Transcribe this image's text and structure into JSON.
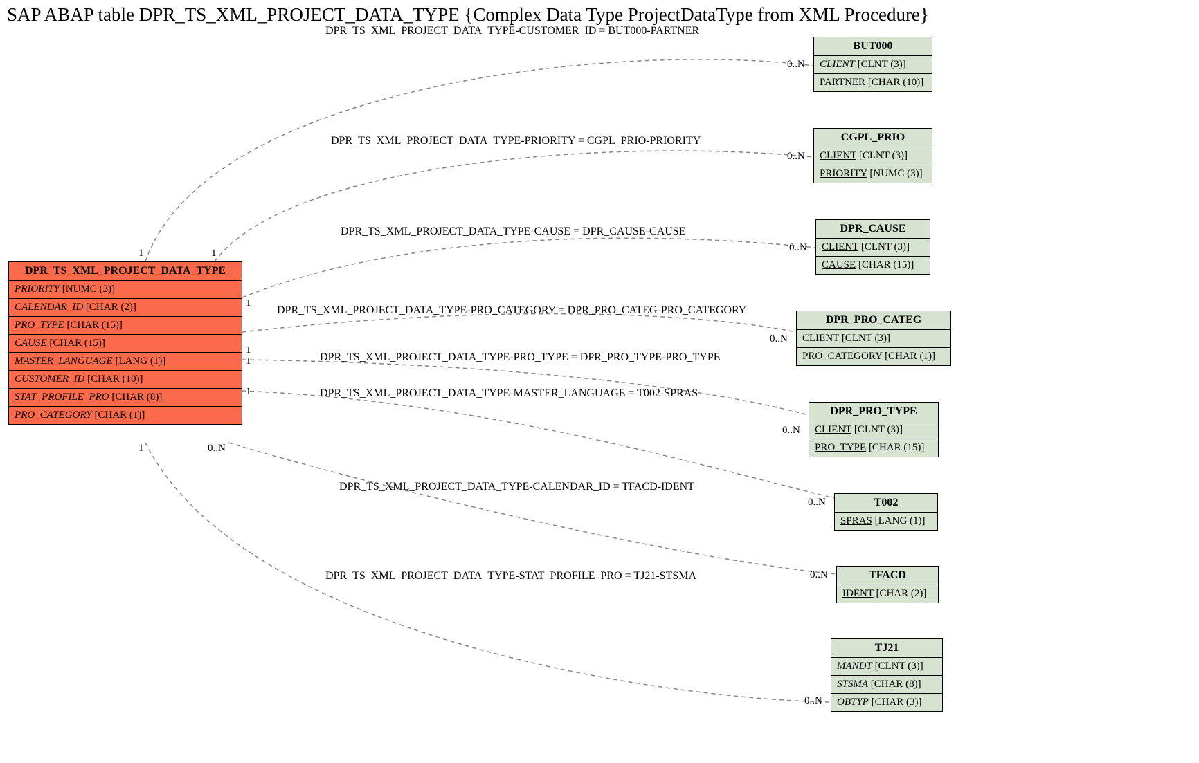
{
  "title": "SAP ABAP table DPR_TS_XML_PROJECT_DATA_TYPE {Complex Data Type ProjectDataType from XML Procedure}",
  "main_entity": {
    "name": "DPR_TS_XML_PROJECT_DATA_TYPE",
    "fields": [
      {
        "name": "PRIORITY",
        "type": "[NUMC (3)]"
      },
      {
        "name": "CALENDAR_ID",
        "type": "[CHAR (2)]"
      },
      {
        "name": "PRO_TYPE",
        "type": "[CHAR (15)]"
      },
      {
        "name": "CAUSE",
        "type": "[CHAR (15)]"
      },
      {
        "name": "MASTER_LANGUAGE",
        "type": "[LANG (1)]"
      },
      {
        "name": "CUSTOMER_ID",
        "type": "[CHAR (10)]"
      },
      {
        "name": "STAT_PROFILE_PRO",
        "type": "[CHAR (8)]"
      },
      {
        "name": "PRO_CATEGORY",
        "type": "[CHAR (1)]"
      }
    ]
  },
  "targets": [
    {
      "name": "BUT000",
      "fields": [
        {
          "name": "CLIENT",
          "type": "[CLNT (3)]",
          "italic": true
        },
        {
          "name": "PARTNER",
          "type": "[CHAR (10)]",
          "italic": false
        }
      ]
    },
    {
      "name": "CGPL_PRIO",
      "fields": [
        {
          "name": "CLIENT",
          "type": "[CLNT (3)]",
          "italic": false
        },
        {
          "name": "PRIORITY",
          "type": "[NUMC (3)]",
          "italic": false
        }
      ]
    },
    {
      "name": "DPR_CAUSE",
      "fields": [
        {
          "name": "CLIENT",
          "type": "[CLNT (3)]",
          "italic": false
        },
        {
          "name": "CAUSE",
          "type": "[CHAR (15)]",
          "italic": false
        }
      ]
    },
    {
      "name": "DPR_PRO_CATEG",
      "fields": [
        {
          "name": "CLIENT",
          "type": "[CLNT (3)]",
          "italic": false
        },
        {
          "name": "PRO_CATEGORY",
          "type": "[CHAR (1)]",
          "italic": false
        }
      ]
    },
    {
      "name": "DPR_PRO_TYPE",
      "fields": [
        {
          "name": "CLIENT",
          "type": "[CLNT (3)]",
          "italic": false
        },
        {
          "name": "PRO_TYPE",
          "type": "[CHAR (15)]",
          "italic": false
        }
      ]
    },
    {
      "name": "T002",
      "fields": [
        {
          "name": "SPRAS",
          "type": "[LANG (1)]",
          "italic": false
        }
      ]
    },
    {
      "name": "TFACD",
      "fields": [
        {
          "name": "IDENT",
          "type": "[CHAR (2)]",
          "italic": false
        }
      ]
    },
    {
      "name": "TJ21",
      "fields": [
        {
          "name": "MANDT",
          "type": "[CLNT (3)]",
          "italic": true
        },
        {
          "name": "STSMA",
          "type": "[CHAR (8)]",
          "italic": true
        },
        {
          "name": "OBTYP",
          "type": "[CHAR (3)]",
          "italic": true
        }
      ]
    }
  ],
  "relations": [
    "DPR_TS_XML_PROJECT_DATA_TYPE-CUSTOMER_ID = BUT000-PARTNER",
    "DPR_TS_XML_PROJECT_DATA_TYPE-PRIORITY = CGPL_PRIO-PRIORITY",
    "DPR_TS_XML_PROJECT_DATA_TYPE-CAUSE = DPR_CAUSE-CAUSE",
    "DPR_TS_XML_PROJECT_DATA_TYPE-PRO_CATEGORY = DPR_PRO_CATEG-PRO_CATEGORY",
    "DPR_TS_XML_PROJECT_DATA_TYPE-PRO_TYPE = DPR_PRO_TYPE-PRO_TYPE",
    "DPR_TS_XML_PROJECT_DATA_TYPE-MASTER_LANGUAGE = T002-SPRAS",
    "DPR_TS_XML_PROJECT_DATA_TYPE-CALENDAR_ID = TFACD-IDENT",
    "DPR_TS_XML_PROJECT_DATA_TYPE-STAT_PROFILE_PRO = TJ21-STSMA"
  ],
  "card_left": "1",
  "card_right": "0..N",
  "card_left_multi": "0..N"
}
